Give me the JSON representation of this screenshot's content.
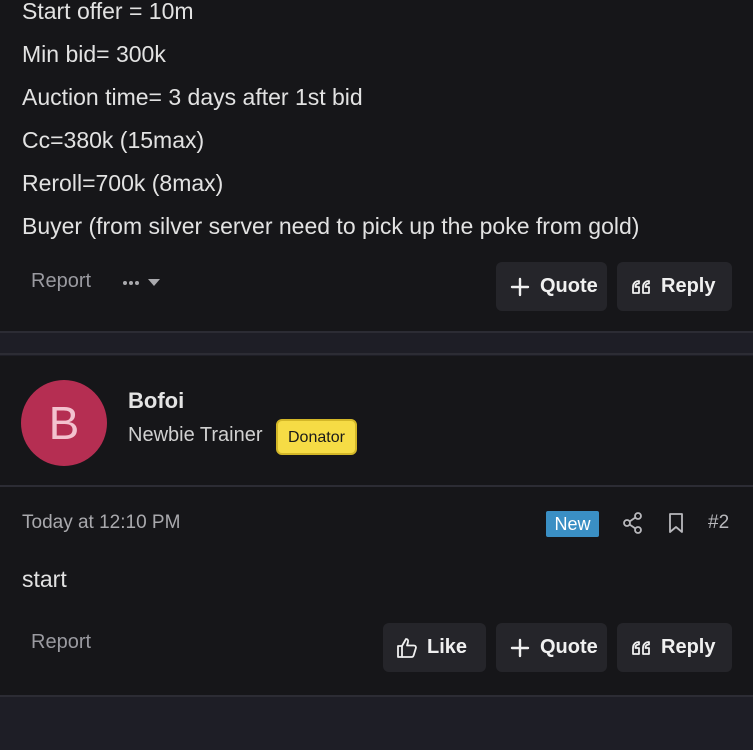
{
  "post1": {
    "lines": [
      "Start offer = 10m",
      "Min bid= 300k",
      "Auction time= 3 days after 1st bid",
      "Cc=380k (15max)",
      "Reroll=700k (8max)",
      "Buyer (from silver server need to pick up the poke from gold)"
    ],
    "report_label": "Report",
    "quote_label": "Quote",
    "reply_label": "Reply"
  },
  "post2": {
    "avatar_letter": "B",
    "username": "Bofoi",
    "user_title": "Newbie Trainer",
    "badge": "Donator",
    "timestamp": "Today at 12:10 PM",
    "new_badge": "New",
    "post_number": "#2",
    "body": "start",
    "report_label": "Report",
    "like_label": "Like",
    "quote_label": "Quote",
    "reply_label": "Reply"
  },
  "icons": {
    "plus": "plus-icon",
    "quote_marks": "quote-marks-icon",
    "thumbs_up": "thumbs-up-icon",
    "share": "share-icon",
    "bookmark": "bookmark-icon",
    "more": "more-options-icon"
  },
  "colors": {
    "avatar": "#b52e52",
    "donator_badge": "#f6dc45",
    "new_badge": "#3a8fc4",
    "post_background": "#161619",
    "page_background": "#1e1e26"
  }
}
